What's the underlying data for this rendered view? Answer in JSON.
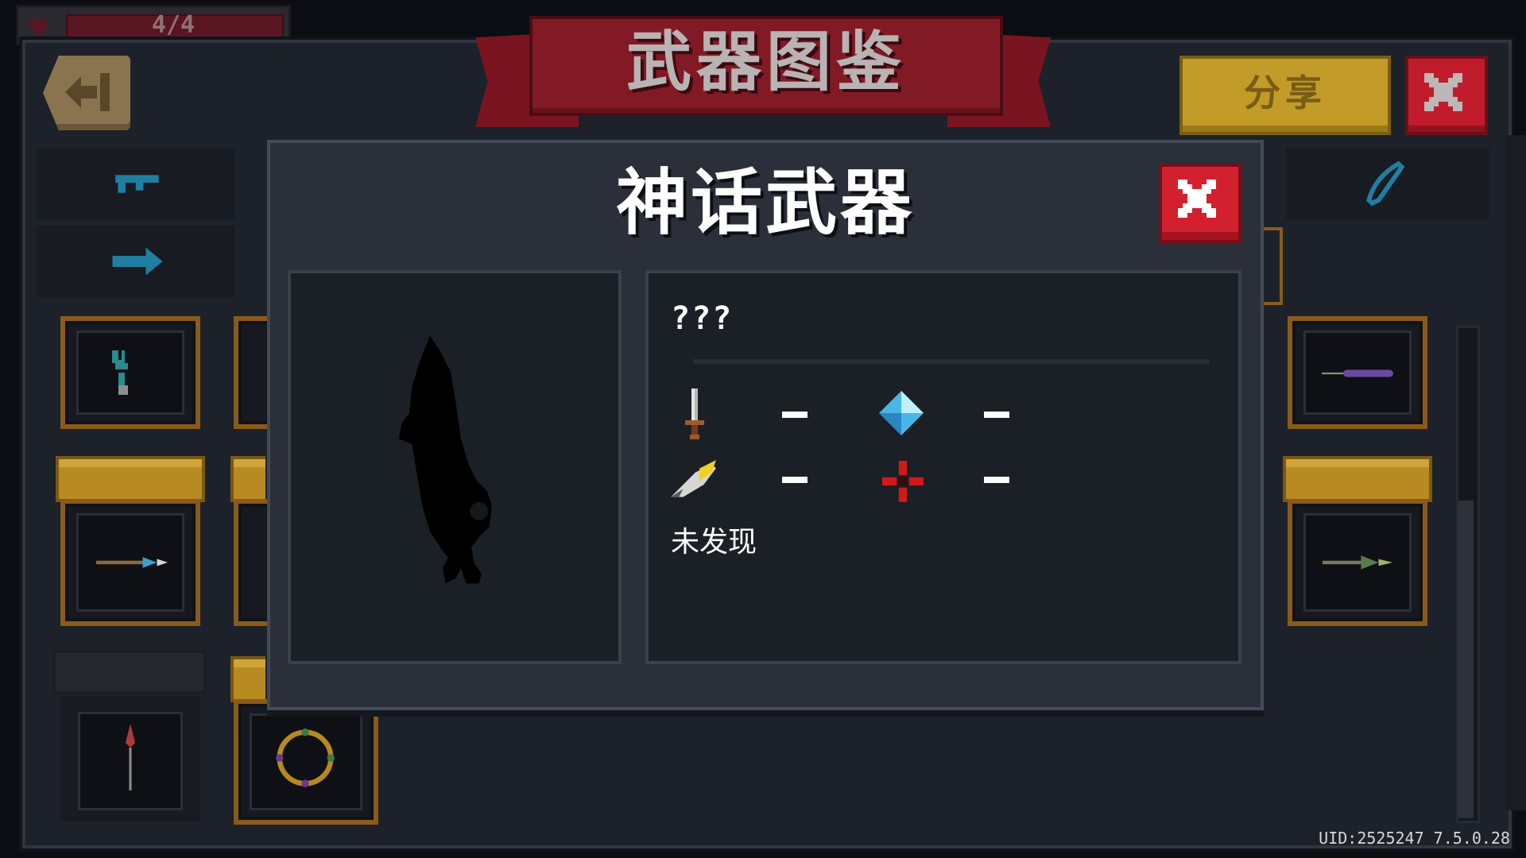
{
  "hud": {
    "hp_text": "4/4"
  },
  "header": {
    "title": "武器图鉴",
    "share_label": "分享"
  },
  "modal": {
    "title": "神话武器",
    "weapon_name": "???",
    "stats": [
      {
        "icon": "sword-damage-icon",
        "value": "—"
      },
      {
        "icon": "energy-crystal-icon",
        "value": "—"
      },
      {
        "icon": "critical-feather-icon",
        "value": "—"
      },
      {
        "icon": "accuracy-crosshair-icon",
        "value": "—"
      }
    ],
    "status": "未发现"
  },
  "footer": {
    "uid_text": "UID:2525247 7.5.0.28"
  },
  "colors": {
    "ribbon_red": "#821a26",
    "close_red": "#d2202f",
    "share_gold": "#c29b29",
    "frame_gold": "#8a5a1c",
    "panel_bg": "#2a2f39"
  }
}
